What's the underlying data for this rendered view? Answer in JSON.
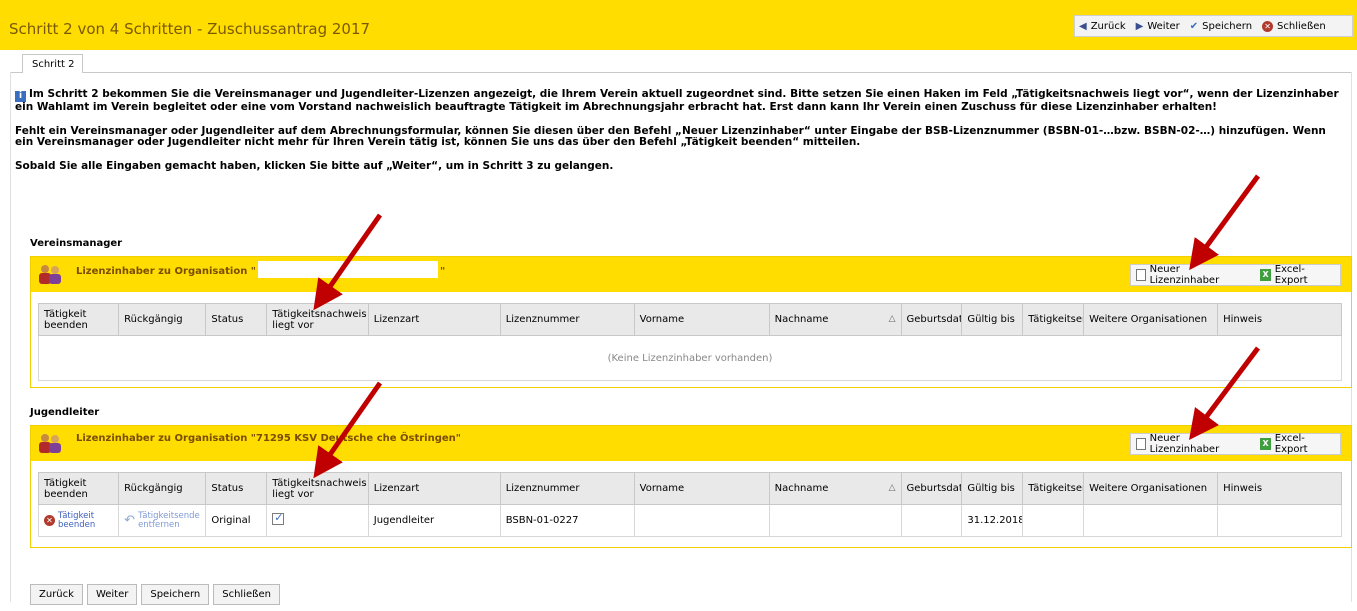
{
  "window": {
    "title": "Schritt 2 von 4 Schritten - Zuschussantrag 2017",
    "toolbar": {
      "back": "Zurück",
      "next": "Weiter",
      "save": "Speichern",
      "close": "Schließen"
    }
  },
  "tabs": [
    {
      "label": "Schritt 2"
    }
  ],
  "info": {
    "p1": "Im Schritt 2 bekommen Sie die Vereinsmanager und Jugendleiter-Lizenzen angezeigt, die Ihrem Verein aktuell zugeordnet sind. Bitte setzen Sie einen Haken im Feld „Tätigkeitsnachweis liegt vor“, wenn der Lizenzinhaber ein Wahlamt im Verein begleitet oder eine vom Vorstand nachweislich beauftragte Tätigkeit im Abrechnungsjahr erbracht hat. Erst dann kann Ihr Verein einen Zuschuss für diese Lizenzinhaber erhalten!",
    "p2": "Fehlt ein Vereinsmanager oder Jugendleiter auf dem Abrechnungsformular, können Sie diesen über den Befehl „Neuer Lizenzinhaber“ unter Eingabe der BSB-Lizenznummer (BSBN-01-…bzw. BSBN-02-…) hinzufügen. Wenn ein Vereinsmanager oder Jugendleiter nicht mehr für Ihren Verein tätig ist, können Sie uns das über den Befehl „Tätigkeit beenden“ mitteilen.",
    "p3": "Sobald Sie alle Eingaben gemacht haben, klicken Sie bitte auf „Weiter“, um in Schritt 3 zu gelangen."
  },
  "columns": [
    "Tätigkeit beenden",
    "Rückgängig",
    "Status",
    "Tätigkeitsnachweis liegt vor",
    "Lizenzart",
    "Lizenznummer",
    "Vorname",
    "Nachname",
    "Geburtsdatu",
    "Gültig bis",
    "Tätigkeitsen",
    "Weitere Organisationen",
    "Hinweis"
  ],
  "sort_indicator": "△",
  "panel_actions": {
    "new": "Neuer Lizenzinhaber",
    "export": "Excel-Export"
  },
  "vereinsmanager": {
    "section_label": "Vereinsmanager",
    "header_prefix": "Lizenzinhaber zu Organisation \"",
    "header_suffix": "\"",
    "empty_text": "(Keine Lizenzinhaber vorhanden)"
  },
  "jugendleiter": {
    "section_label": "Jugendleiter",
    "header": "Lizenzinhaber zu Organisation \"71295 KSV Deutsche  che Östringen\"",
    "rows": [
      {
        "end_line1": "Tätigkeit",
        "end_line2": "beenden",
        "undo_line1": "Tätigkeitsende",
        "undo_line2": "entfernen",
        "status": "Original",
        "nachweis_checked": true,
        "lizenzart": "Jugendleiter",
        "lizenznummer": "BSBN-01-0227",
        "vorname": "",
        "nachname": "",
        "geburtsdatum": "",
        "gueltig_bis": "31.12.2018",
        "taetigkeitsende": "",
        "weitere": "",
        "hinweis": ""
      }
    ]
  },
  "bottom_buttons": {
    "back": "Zurück",
    "next": "Weiter",
    "save": "Speichern",
    "close": "Schließen"
  },
  "colors": {
    "accent_yellow": "#ffdd00",
    "arrow_red": "#c00000",
    "link_blue": "#3d5fbf"
  },
  "icons": [
    "back-icon",
    "next-icon",
    "save-check-icon",
    "close-icon",
    "info-icon",
    "people-icon",
    "document-icon",
    "excel-icon",
    "cancel-circle-icon",
    "undo-icon",
    "checkbox-checked-icon",
    "sort-icon"
  ]
}
